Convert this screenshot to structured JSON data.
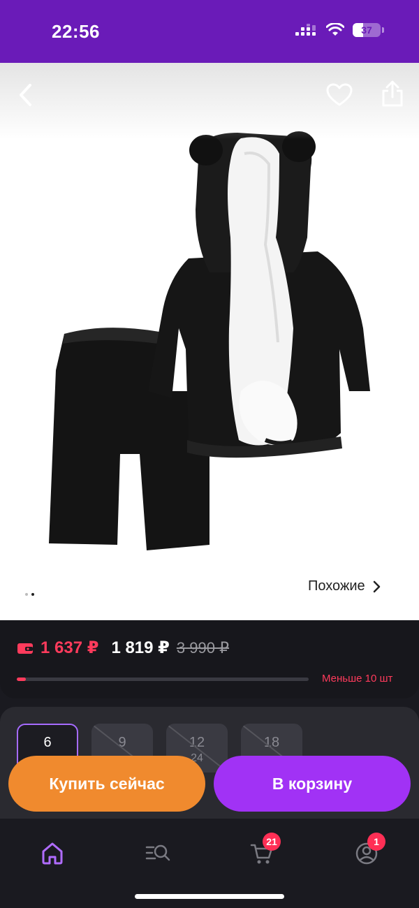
{
  "status_bar": {
    "time": "22:56",
    "battery": "37",
    "battery_level": 0.37,
    "icons": [
      "signal-icon",
      "wifi-icon",
      "battery-icon"
    ]
  },
  "product": {
    "image_icon": "skunk-costume-photo",
    "similar_label": "Похожие",
    "gallery_count": 2,
    "gallery_active": 2
  },
  "price": {
    "wallet_price": "1 637 ₽",
    "regular_price": "1 819 ₽",
    "old_price": "3 990 ₽",
    "stock_label": "Меньше 10 шт",
    "stock_level": 0.03
  },
  "sizes": [
    {
      "label": "6",
      "sub": "",
      "state": "selected"
    },
    {
      "label": "9",
      "sub": "",
      "state": "unavailable"
    },
    {
      "label": "12",
      "sub": "24",
      "state": "unavailable"
    },
    {
      "label": "18",
      "sub": "",
      "state": "unavailable"
    }
  ],
  "actions": {
    "buy_now": "Купить сейчас",
    "add_to_cart": "В корзину"
  },
  "tabs": {
    "cart_badge": "21",
    "profile_badge": "1"
  },
  "colors": {
    "brand": "#6a1bb8",
    "accent_purple": "#a132f5",
    "accent_orange": "#f08a2e",
    "sale_red": "#ff3b5c"
  }
}
